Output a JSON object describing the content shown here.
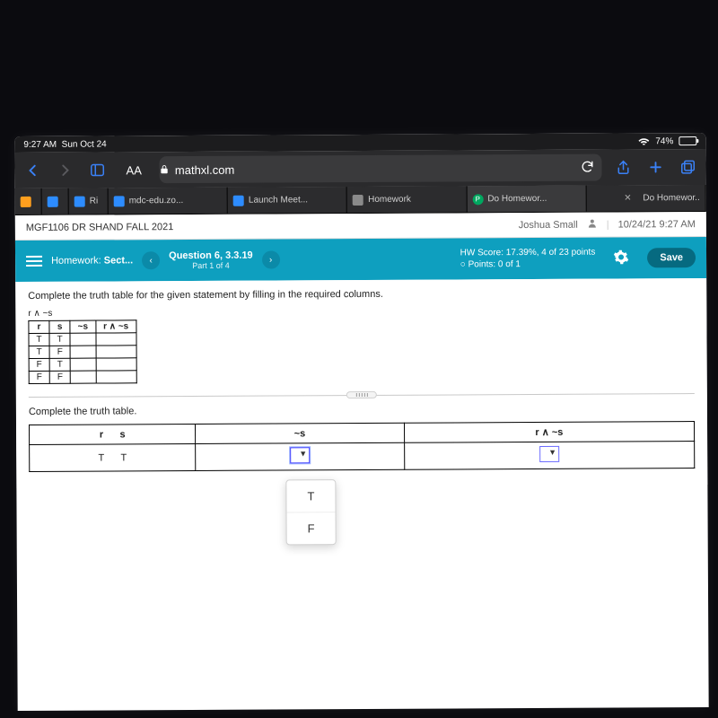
{
  "status": {
    "time": "9:27 AM",
    "date": "Sun Oct 24",
    "battery_pct": "74%"
  },
  "safari": {
    "aa": "AA",
    "domain": "mathxl.com"
  },
  "tabs": [
    {
      "label": "Ri",
      "color": "#2d66ff"
    },
    {
      "label": "mdc-edu.zo...",
      "color": "#2d66ff"
    },
    {
      "label": "Launch Meet...",
      "color": "#2d66ff"
    },
    {
      "label": "Homework",
      "color": "#8a8a8a"
    },
    {
      "label": "Do Homewor...",
      "color": "#00a860"
    },
    {
      "label": "Do Homewor..",
      "color": "#8a8a8a"
    }
  ],
  "course": {
    "title": "MGF1106 DR SHAND FALL 2021",
    "student": "Joshua Small",
    "timestamp": "10/24/21 9:27 AM"
  },
  "hw": {
    "label": "Homework:",
    "section": "Sect...",
    "question_line": "Question 6, 3.3.19",
    "part": "Part 1 of 4",
    "score_line": "HW Score: 17.39%, 4 of 23 points",
    "points_line": "Points: 0 of 1",
    "save": "Save"
  },
  "problem": {
    "instruction": "Complete the truth table for the given statement by filling in the required columns.",
    "expr": "r ∧ ~s",
    "headers": {
      "r": "r",
      "s": "s",
      "ns": "~s",
      "rns": "r ∧ ~s"
    },
    "rows": [
      {
        "r": "T",
        "s": "T"
      },
      {
        "r": "T",
        "s": "F"
      },
      {
        "r": "F",
        "s": "T"
      },
      {
        "r": "F",
        "s": "F"
      }
    ],
    "sub_instruction": "Complete the truth table.",
    "answer_row": {
      "r": "T",
      "s": "T"
    },
    "options": {
      "t": "T",
      "f": "F"
    }
  }
}
